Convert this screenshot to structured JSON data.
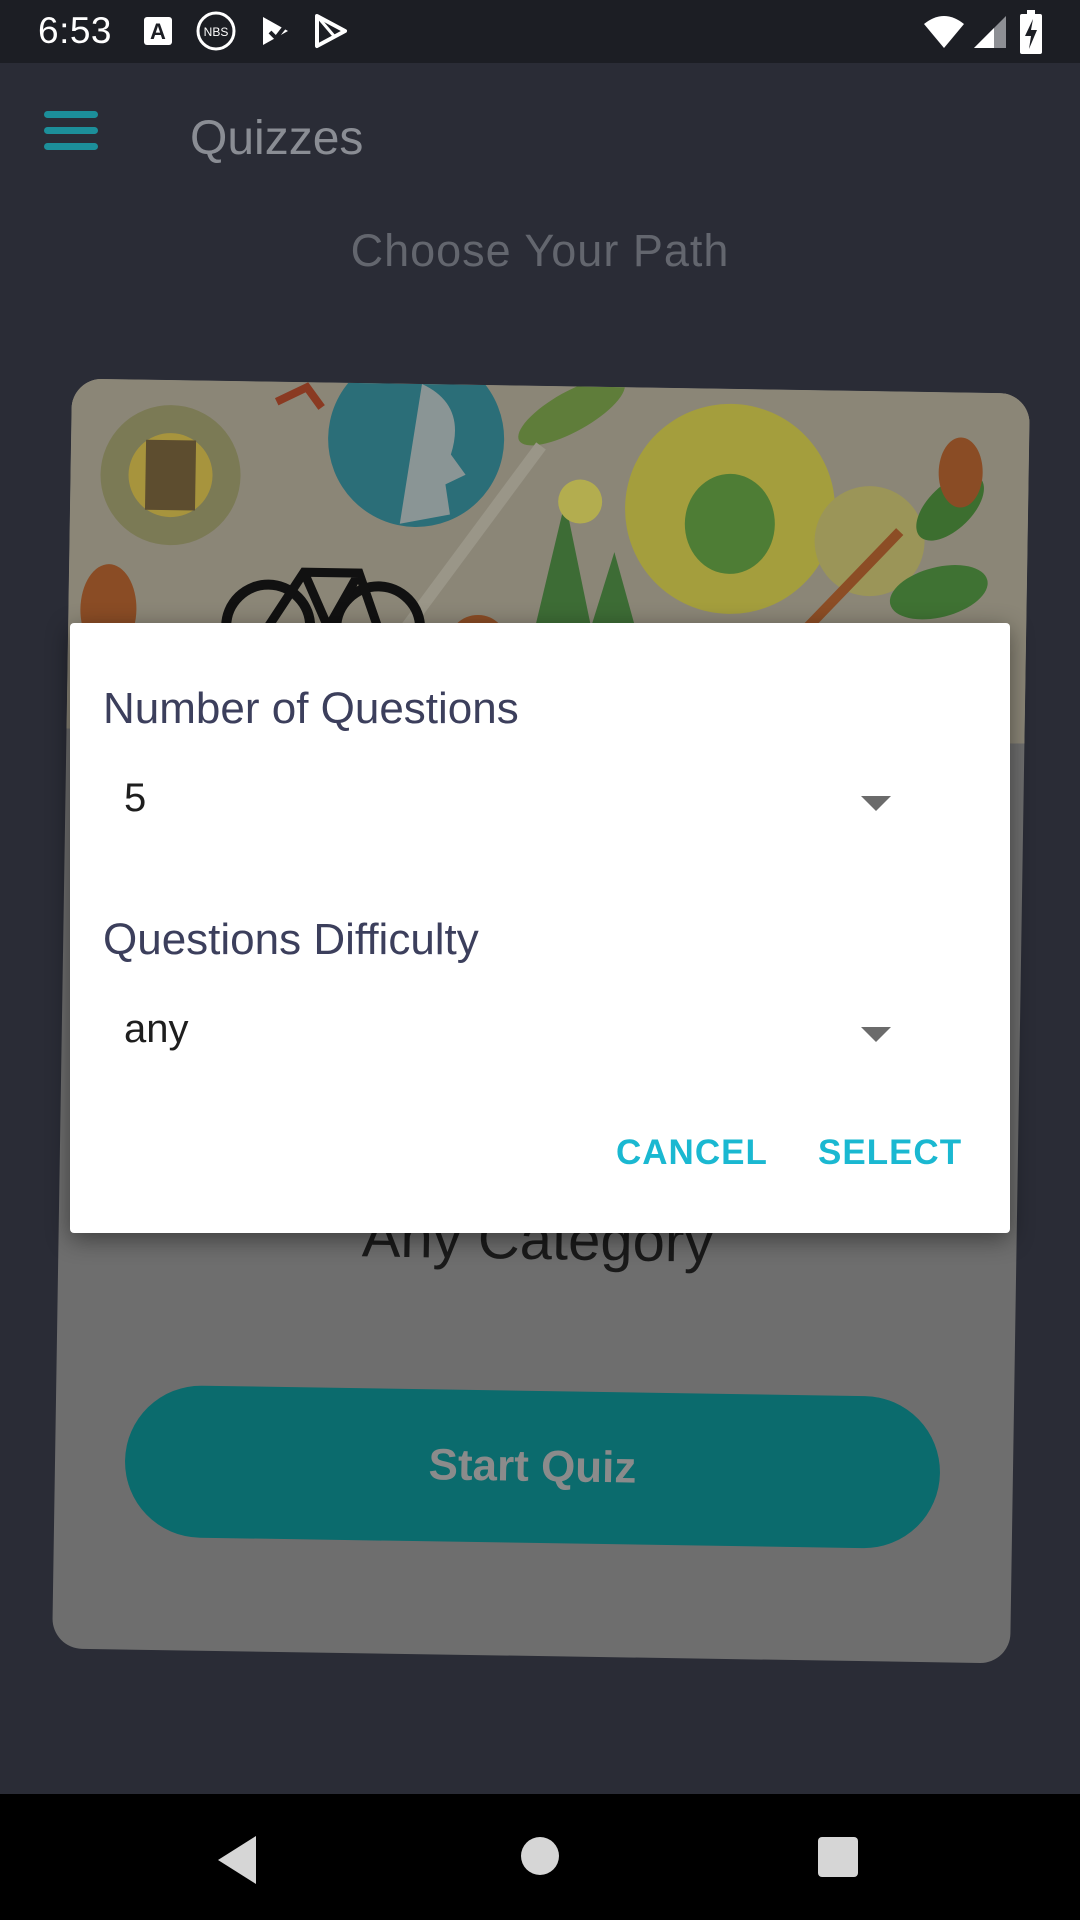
{
  "status_bar": {
    "time": "6:53",
    "icons_left": [
      "a-icon",
      "nbs-icon",
      "checkmark-play-icon",
      "play-store-icon"
    ],
    "icons_right": [
      "wifi-icon",
      "cell-signal-icon",
      "battery-charging-icon"
    ]
  },
  "app_bar": {
    "title": "Quizzes",
    "menu_icon": "hamburger-menu-icon"
  },
  "main": {
    "subtitle": "Choose Your Path",
    "card": {
      "category": "Any Category",
      "start_button_label": "Start Quiz"
    }
  },
  "dialog": {
    "questions_label": "Number of Questions",
    "questions_value": "5",
    "difficulty_label": "Questions Difficulty",
    "difficulty_value": "any",
    "cancel_label": "CANCEL",
    "select_label": "SELECT"
  },
  "colors": {
    "accent": "#1ab8d1",
    "teal_button": "#0b6b6d",
    "dialog_text": "#3c3f5c",
    "background": "#2a2c36"
  },
  "nav_bar": {
    "icons": [
      "back-icon",
      "home-icon",
      "recents-icon"
    ]
  }
}
